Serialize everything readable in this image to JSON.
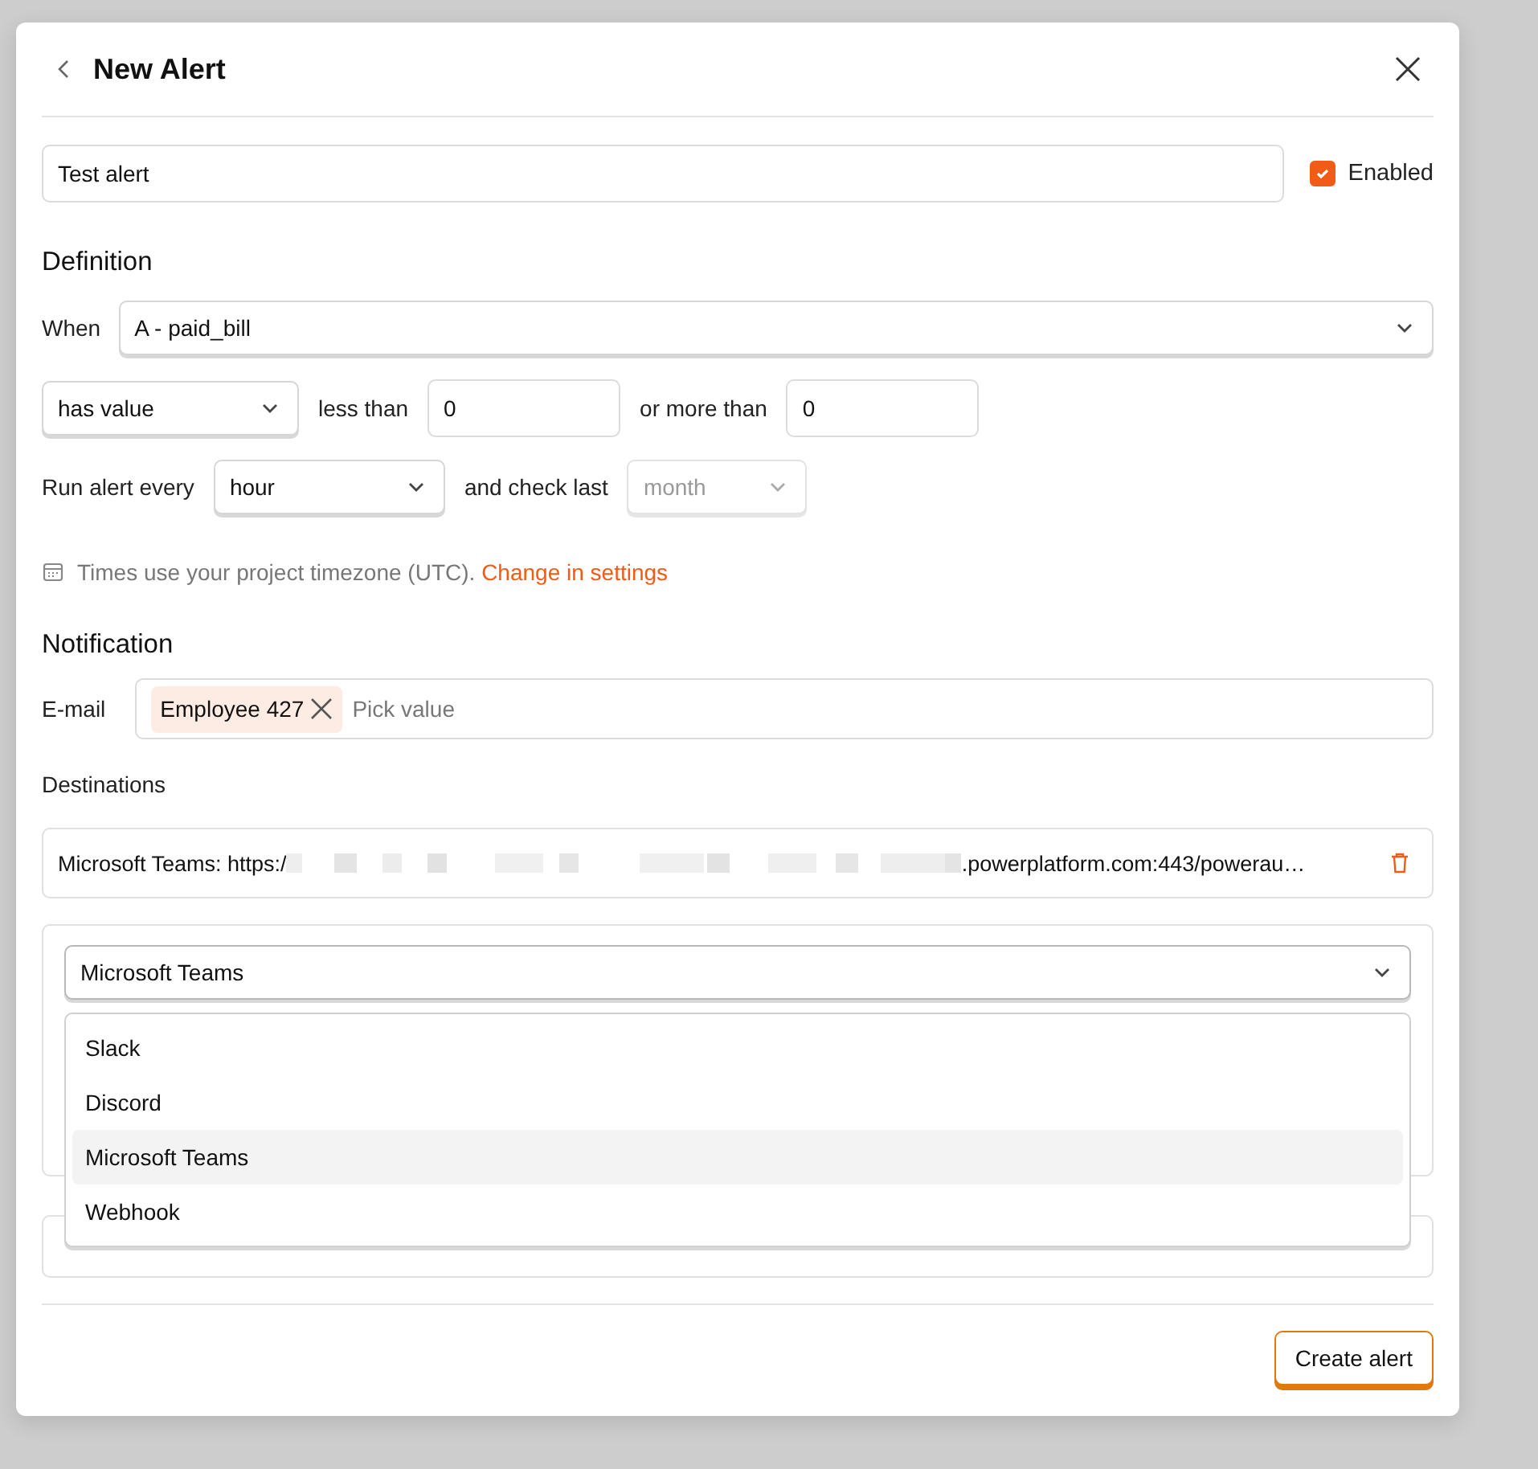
{
  "header": {
    "title": "New Alert"
  },
  "name_field": {
    "value": "Test alert"
  },
  "enabled": {
    "label": "Enabled",
    "checked": true
  },
  "definition": {
    "heading": "Definition",
    "when_label": "When",
    "event_select": {
      "value": "A - paid_bill",
      "disabled": false
    },
    "condition_select": {
      "value": "has value",
      "disabled": false
    },
    "less_than_label": "less than",
    "less_than_field": {
      "value": "0"
    },
    "more_than_label": "or more than",
    "more_than_field": {
      "value": "0"
    },
    "run_label": "Run alert every",
    "interval_select": {
      "value": "hour",
      "disabled": false
    },
    "check_label": "and check last",
    "check_select": {
      "value": "month",
      "disabled": true
    },
    "timezone_note": "Times use your project timezone (UTC).",
    "settings_link": "Change in settings"
  },
  "notification": {
    "heading": "Notification",
    "email_label": "E-mail",
    "email_chips": [
      {
        "label": "Employee 427"
      }
    ],
    "email_placeholder": "Pick value"
  },
  "destinations": {
    "heading": "Destinations",
    "items": [
      {
        "prefix": "Microsoft Teams: https:/",
        "suffix": ".powerplatform.com:443/powerau…"
      }
    ],
    "new_destination": {
      "type_select": {
        "value": "Microsoft Teams",
        "disabled": false,
        "expanded": true
      },
      "options": [
        {
          "label": "Slack",
          "selected": false
        },
        {
          "label": "Discord",
          "selected": false
        },
        {
          "label": "Microsoft Teams",
          "selected": true
        },
        {
          "label": "Webhook",
          "selected": false
        }
      ]
    }
  },
  "footer": {
    "create_button": "Create alert"
  }
}
